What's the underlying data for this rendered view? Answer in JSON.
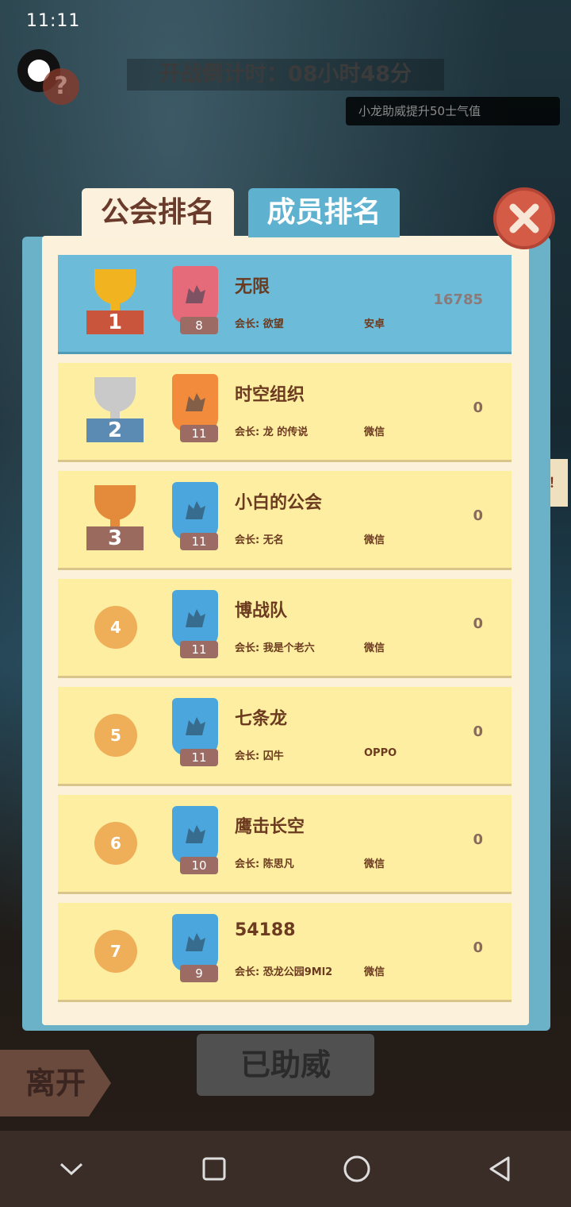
{
  "status": {
    "time": "11:11"
  },
  "header": {
    "help_icon": "?",
    "countdown": "开战倒计时：08小时48分",
    "toast": "小龙助威提升50士气值"
  },
  "tabs": [
    {
      "label": "公会排名",
      "active": true
    },
    {
      "label": "成员排名",
      "active": false
    }
  ],
  "leader_prefix": "会长:",
  "rankings": [
    {
      "rank": "1",
      "trophy": "gold-trophy",
      "level": "8",
      "emblem": "pink",
      "name": "无限",
      "leader": "会长: 欲望",
      "platform": "安卓",
      "score": "16785"
    },
    {
      "rank": "2",
      "trophy": "silver-trophy",
      "level": "11",
      "emblem": "orange",
      "name": "时空组织",
      "leader": "会长: 龙 的传说",
      "platform": "微信",
      "score": "0"
    },
    {
      "rank": "3",
      "trophy": "bronze-trophy",
      "level": "11",
      "emblem": "blue",
      "name": "小白的公会",
      "leader": "会长: 无名",
      "platform": "微信",
      "score": "0"
    },
    {
      "rank": "4",
      "level": "11",
      "emblem": "blue",
      "name": "博战队",
      "leader": "会长: 我是个老六",
      "platform": "微信",
      "score": "0"
    },
    {
      "rank": "5",
      "level": "11",
      "emblem": "blue",
      "name": "七条龙",
      "leader": "会长: 囚牛",
      "platform": "OPPO",
      "score": "0"
    },
    {
      "rank": "6",
      "level": "10",
      "emblem": "blue",
      "name": "鹰击长空",
      "leader": "会长: 陈思凡",
      "platform": "微信",
      "score": "0"
    },
    {
      "rank": "7",
      "level": "9",
      "emblem": "blue",
      "name": "54188",
      "leader": "会长: 恐龙公园9Ml2",
      "platform": "微信",
      "score": "0"
    }
  ],
  "bottom": {
    "leave": "离开",
    "cheered": "已助威",
    "side_chat": "吧！"
  },
  "colors": {
    "row_first": "#6bbbd9",
    "row": "#fdeea2",
    "tab_active": "#fbf1dc",
    "tab_inactive": "#5fb2cf",
    "close": "#d45b46"
  },
  "icons": [
    "close-icon",
    "help-icon",
    "trophy-icon",
    "wolf-emblem-icon",
    "chevron-down-icon",
    "square-icon",
    "circle-icon",
    "back-triangle-icon"
  ]
}
